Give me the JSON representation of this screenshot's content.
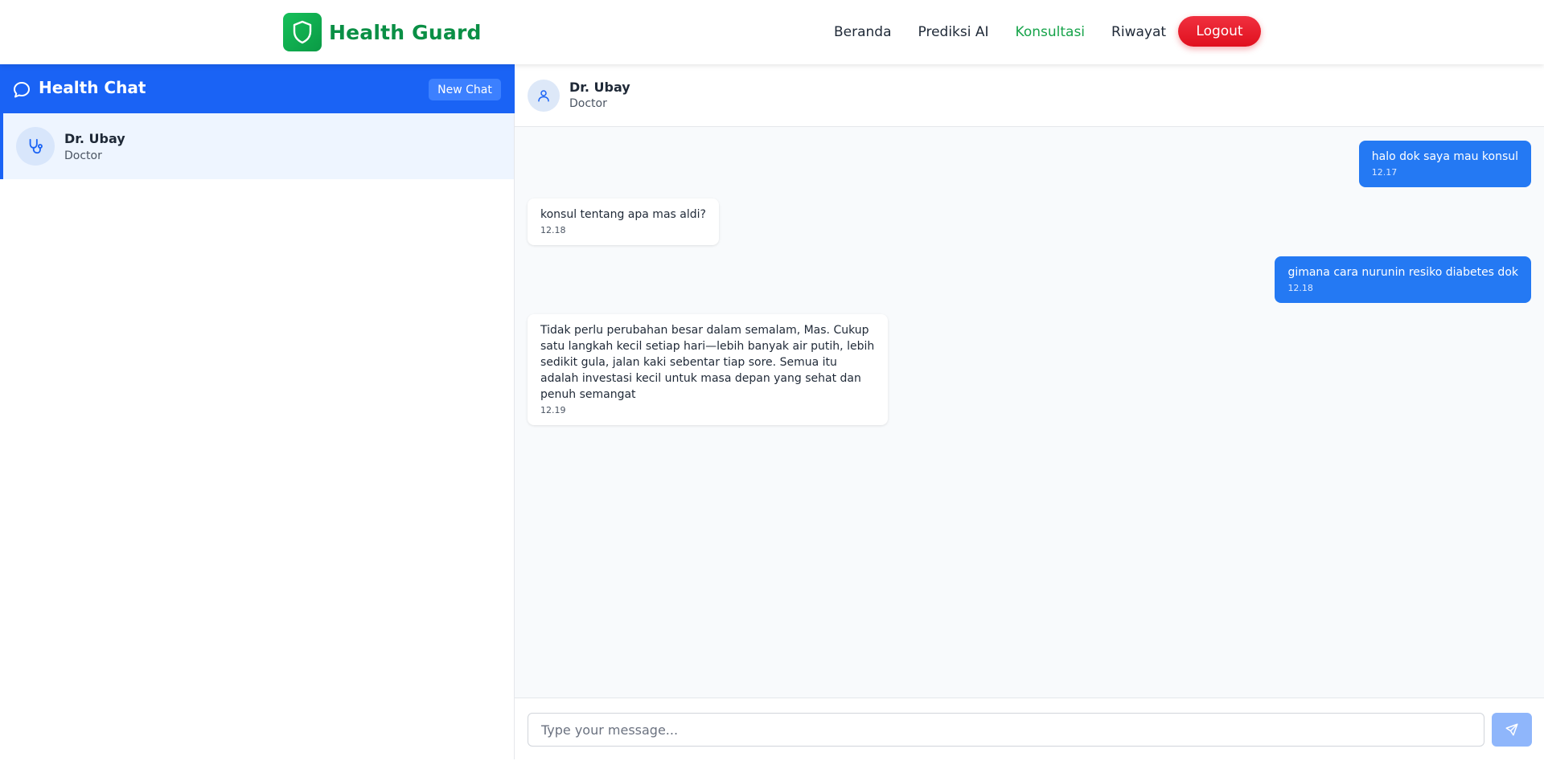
{
  "brand": {
    "name": "Health Guard",
    "logo_icon": "shield-icon"
  },
  "nav": {
    "links": [
      {
        "label": "Beranda"
      },
      {
        "label": "Prediksi AI"
      },
      {
        "label": "Konsultasi",
        "active": true
      },
      {
        "label": "Riwayat"
      }
    ],
    "logout_label": "Logout"
  },
  "sidebar": {
    "title": "Health Chat",
    "title_icon": "chat-bubble-icon",
    "new_chat_label": "New Chat",
    "contacts": [
      {
        "name": "Dr. Ubay",
        "role": "Doctor",
        "icon": "stethoscope-icon",
        "selected": true
      }
    ]
  },
  "chat": {
    "header": {
      "name": "Dr. Ubay",
      "role": "Doctor",
      "icon": "user-icon"
    },
    "messages": [
      {
        "direction": "out",
        "text": "halo dok saya mau konsul",
        "time": "12.17"
      },
      {
        "direction": "in",
        "text": "konsul tentang apa mas aldi?",
        "time": "12.18"
      },
      {
        "direction": "out",
        "text": "gimana cara nurunin resiko diabetes dok",
        "time": "12.18"
      },
      {
        "direction": "in",
        "text": "Tidak perlu perubahan besar dalam semalam, Mas. Cukup satu langkah kecil setiap hari—lebih banyak air putih, lebih sedikit gula, jalan kaki sebentar tiap sore. Semua itu adalah investasi kecil untuk masa depan yang sehat dan penuh semangat",
        "time": "12.19"
      }
    ],
    "input": {
      "value": "",
      "placeholder": "Type your message..."
    },
    "send_icon": "send-icon"
  },
  "colors": {
    "brand_green": "#0a8f45",
    "nav_active": "#16a34a",
    "logout_red": "#e0101e",
    "sidebar_blue": "#1a63f5",
    "outgoing_bubble": "#2479f3"
  }
}
